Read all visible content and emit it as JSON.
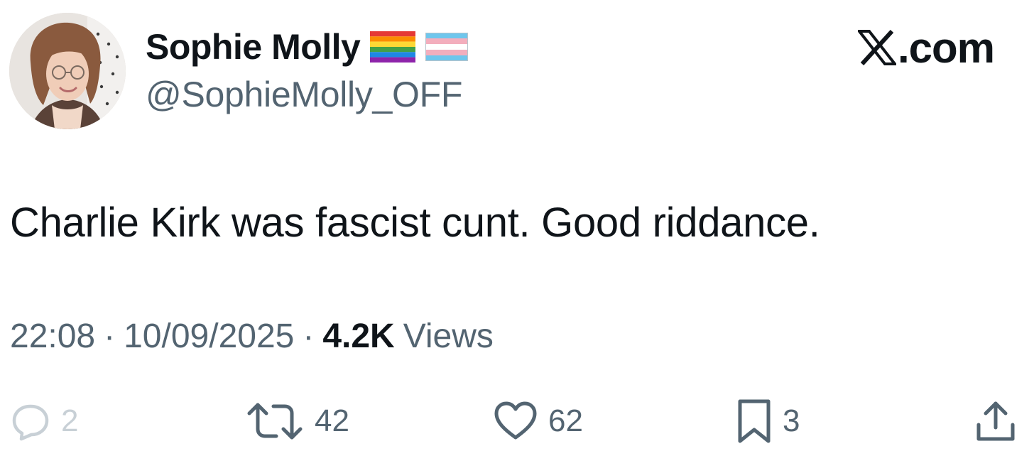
{
  "author": {
    "display_name": "Sophie Molly",
    "handle": "@SophieMolly_OFF",
    "flags": [
      "rainbow-flag",
      "transgender-flag"
    ]
  },
  "brand": {
    "label": ".com",
    "icon": "x-logo-icon"
  },
  "tweet": {
    "text": "Charlie Kirk was fascist cunt. Good riddance.",
    "time": "22:08",
    "date": "10/09/2025",
    "separator": "·",
    "views_count": "4.2K",
    "views_label": "Views"
  },
  "actions": {
    "reply": {
      "icon": "reply-icon",
      "count": "2"
    },
    "retweet": {
      "icon": "retweet-icon",
      "count": "42"
    },
    "like": {
      "icon": "heart-icon",
      "count": "62"
    },
    "bookmark": {
      "icon": "bookmark-icon",
      "count": "3"
    },
    "share": {
      "icon": "share-icon"
    }
  },
  "colors": {
    "text_primary": "#0f1419",
    "text_secondary": "#536471",
    "faded": "#c8d0d6"
  }
}
